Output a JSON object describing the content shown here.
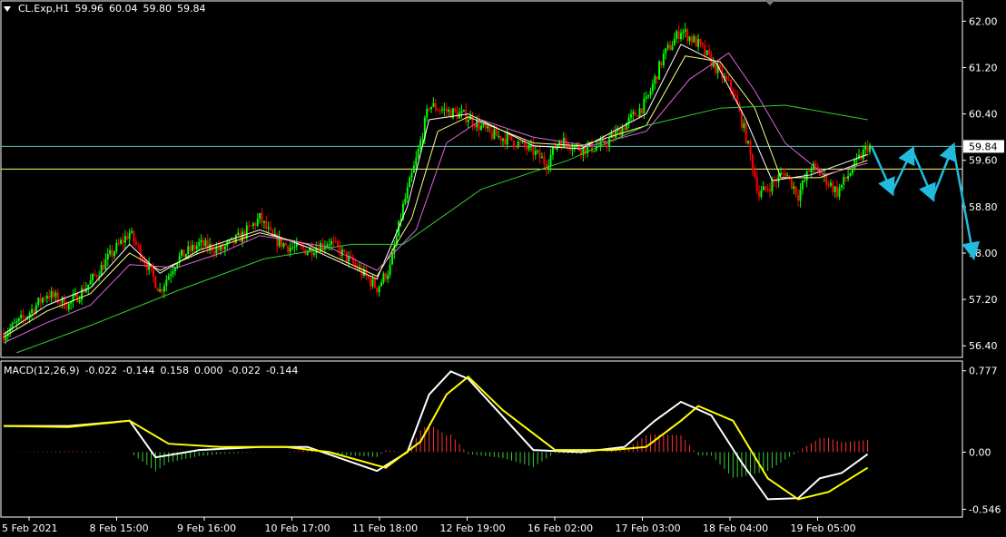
{
  "header": {
    "symbol": "CL.Exp,H1",
    "open": "59.96",
    "high": "60.04",
    "low": "59.80",
    "close": "59.84"
  },
  "macd_header": {
    "label": "MACD(12,26,9)",
    "values": [
      "-0.022",
      "-0.144",
      "0.158",
      "0.000",
      "-0.022",
      "-0.144"
    ]
  },
  "colors": {
    "background": "#000000",
    "frame": "#ffffff",
    "bull_candle": "#00ff00",
    "bear_candle": "#ff0000",
    "ma_fast": "#ffffff",
    "ma_mid": "#ffff88",
    "ma_slow": "#dd66dd",
    "ma_long": "#33cc33",
    "macd_line": "#ffffff",
    "signal_line": "#ffff00",
    "hist_pos": "#ff3333",
    "hist_neg": "#33cc33",
    "forecast_arrow": "#22bbdd",
    "hline_1": "#66bbbb",
    "hline_2": "#ffff66"
  },
  "chart_data": [
    {
      "type": "candlestick",
      "title": "CL.Exp,H1",
      "ylim": [
        56.2,
        62.35
      ],
      "y_ticks": [
        "62.00",
        "61.20",
        "60.40",
        "59.60",
        "58.80",
        "58.00",
        "57.20",
        "56.40"
      ],
      "x_ticks": [
        "5 Feb 2021",
        "8 Feb 15:00",
        "9 Feb 16:00",
        "10 Feb 17:00",
        "11 Feb 18:00",
        "12 Feb 19:00",
        "16 Feb 02:00",
        "17 Feb 03:00",
        "18 Feb 04:00",
        "19 Feb 05:00"
      ],
      "current_price": "59.84",
      "horizontal_lines": [
        59.84,
        59.45
      ],
      "close_path": [
        [
          0,
          56.6
        ],
        [
          10,
          56.9
        ],
        [
          20,
          57.3
        ],
        [
          30,
          57.1
        ],
        [
          40,
          57.5
        ],
        [
          50,
          58.0
        ],
        [
          58,
          58.35
        ],
        [
          66,
          57.8
        ],
        [
          72,
          57.35
        ],
        [
          80,
          57.9
        ],
        [
          90,
          58.15
        ],
        [
          100,
          58.05
        ],
        [
          110,
          58.3
        ],
        [
          118,
          58.6
        ],
        [
          124,
          58.25
        ],
        [
          132,
          58.1
        ],
        [
          140,
          58.05
        ],
        [
          150,
          58.2
        ],
        [
          160,
          57.85
        ],
        [
          172,
          57.4
        ],
        [
          178,
          57.75
        ],
        [
          184,
          58.8
        ],
        [
          190,
          59.6
        ],
        [
          196,
          60.55
        ],
        [
          204,
          60.45
        ],
        [
          214,
          60.35
        ],
        [
          224,
          60.05
        ],
        [
          234,
          59.95
        ],
        [
          244,
          59.75
        ],
        [
          250,
          59.55
        ],
        [
          256,
          59.95
        ],
        [
          266,
          59.8
        ],
        [
          276,
          59.85
        ],
        [
          286,
          60.2
        ],
        [
          296,
          60.6
        ],
        [
          304,
          61.4
        ],
        [
          312,
          61.85
        ],
        [
          320,
          61.6
        ],
        [
          328,
          61.2
        ],
        [
          336,
          60.8
        ],
        [
          342,
          60.0
        ],
        [
          348,
          59.0
        ],
        [
          354,
          59.2
        ],
        [
          360,
          59.4
        ],
        [
          366,
          59.0
        ],
        [
          372,
          59.5
        ],
        [
          378,
          59.3
        ],
        [
          384,
          59.05
        ],
        [
          390,
          59.4
        ],
        [
          398,
          59.84
        ]
      ],
      "series": [
        {
          "name": "MA fast",
          "values": [
            [
              0,
              56.6
            ],
            [
              20,
              57.1
            ],
            [
              40,
              57.4
            ],
            [
              58,
              58.15
            ],
            [
              72,
              57.65
            ],
            [
              90,
              58.05
            ],
            [
              118,
              58.4
            ],
            [
              140,
              58.1
            ],
            [
              172,
              57.55
            ],
            [
              186,
              58.8
            ],
            [
              196,
              60.3
            ],
            [
              214,
              60.4
            ],
            [
              244,
              59.85
            ],
            [
              266,
              59.8
            ],
            [
              296,
              60.4
            ],
            [
              312,
              61.6
            ],
            [
              328,
              61.3
            ],
            [
              342,
              60.3
            ],
            [
              354,
              59.25
            ],
            [
              372,
              59.35
            ],
            [
              398,
              59.7
            ]
          ]
        },
        {
          "name": "MA mid",
          "values": [
            [
              0,
              56.55
            ],
            [
              20,
              57.0
            ],
            [
              40,
              57.3
            ],
            [
              58,
              58.0
            ],
            [
              72,
              57.7
            ],
            [
              90,
              58.0
            ],
            [
              118,
              58.35
            ],
            [
              140,
              58.15
            ],
            [
              172,
              57.6
            ],
            [
              188,
              58.6
            ],
            [
              200,
              60.1
            ],
            [
              214,
              60.35
            ],
            [
              244,
              59.9
            ],
            [
              266,
              59.85
            ],
            [
              296,
              60.2
            ],
            [
              314,
              61.4
            ],
            [
              330,
              61.3
            ],
            [
              346,
              60.5
            ],
            [
              358,
              59.3
            ],
            [
              376,
              59.3
            ],
            [
              398,
              59.6
            ]
          ]
        },
        {
          "name": "MA slow",
          "values": [
            [
              0,
              56.45
            ],
            [
              20,
              56.8
            ],
            [
              40,
              57.1
            ],
            [
              58,
              57.8
            ],
            [
              80,
              57.75
            ],
            [
              100,
              58.0
            ],
            [
              118,
              58.3
            ],
            [
              150,
              58.1
            ],
            [
              172,
              57.7
            ],
            [
              190,
              58.4
            ],
            [
              204,
              59.9
            ],
            [
              220,
              60.3
            ],
            [
              244,
              60.0
            ],
            [
              270,
              59.85
            ],
            [
              296,
              60.1
            ],
            [
              316,
              61.0
            ],
            [
              334,
              61.45
            ],
            [
              346,
              60.8
            ],
            [
              360,
              59.9
            ],
            [
              378,
              59.35
            ],
            [
              398,
              59.55
            ]
          ]
        },
        {
          "name": "MA long",
          "values": [
            [
              6,
              56.28
            ],
            [
              40,
              56.75
            ],
            [
              80,
              57.35
            ],
            [
              120,
              57.9
            ],
            [
              160,
              58.15
            ],
            [
              184,
              58.15
            ],
            [
              220,
              59.1
            ],
            [
              260,
              59.6
            ],
            [
              296,
              60.2
            ],
            [
              330,
              60.5
            ],
            [
              360,
              60.55
            ],
            [
              398,
              60.3
            ]
          ]
        }
      ],
      "forecast_path": [
        [
          59.84,
          0
        ],
        [
          59.05,
          1
        ],
        [
          59.78,
          2
        ],
        [
          58.95,
          3
        ],
        [
          59.84,
          4
        ],
        [
          57.95,
          5
        ]
      ]
    },
    {
      "type": "macd",
      "title": "MACD(12,26,9)",
      "ylim": [
        -0.62,
        0.87
      ],
      "y_ticks": [
        "0.777",
        "0.00",
        "-0.546"
      ],
      "macd_line": [
        [
          0,
          0.25
        ],
        [
          30,
          0.25
        ],
        [
          58,
          0.3
        ],
        [
          70,
          -0.05
        ],
        [
          90,
          0.02
        ],
        [
          118,
          0.05
        ],
        [
          140,
          0.05
        ],
        [
          172,
          -0.18
        ],
        [
          186,
          0.0
        ],
        [
          196,
          0.55
        ],
        [
          206,
          0.77
        ],
        [
          214,
          0.7
        ],
        [
          244,
          0.02
        ],
        [
          266,
          0.0
        ],
        [
          286,
          0.05
        ],
        [
          300,
          0.3
        ],
        [
          312,
          0.48
        ],
        [
          326,
          0.35
        ],
        [
          340,
          -0.1
        ],
        [
          352,
          -0.45
        ],
        [
          366,
          -0.44
        ],
        [
          376,
          -0.25
        ],
        [
          386,
          -0.2
        ],
        [
          398,
          -0.02
        ]
      ],
      "signal_line": [
        [
          0,
          0.25
        ],
        [
          30,
          0.24
        ],
        [
          58,
          0.3
        ],
        [
          76,
          0.08
        ],
        [
          100,
          0.05
        ],
        [
          130,
          0.05
        ],
        [
          150,
          0.0
        ],
        [
          176,
          -0.15
        ],
        [
          192,
          0.1
        ],
        [
          204,
          0.55
        ],
        [
          214,
          0.72
        ],
        [
          230,
          0.4
        ],
        [
          254,
          0.02
        ],
        [
          280,
          0.02
        ],
        [
          296,
          0.05
        ],
        [
          312,
          0.3
        ],
        [
          320,
          0.44
        ],
        [
          336,
          0.3
        ],
        [
          352,
          -0.25
        ],
        [
          366,
          -0.45
        ],
        [
          380,
          -0.38
        ],
        [
          398,
          -0.15
        ]
      ]
    }
  ]
}
